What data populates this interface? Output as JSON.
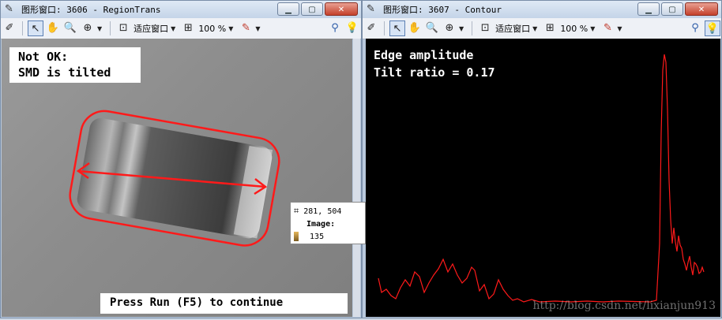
{
  "left_window": {
    "title": "图形窗口: 3606 - RegionTrans",
    "fit_label": "适应窗口",
    "zoom": "100 %",
    "status_lines": [
      "Not OK:",
      "SMD is tilted"
    ],
    "hint": "Press Run (F5) to continue",
    "tooltip": {
      "coords": "281, 504",
      "image_label": "Image:",
      "value": "135"
    }
  },
  "right_window": {
    "title": "图形窗口: 3607 - Contour",
    "fit_label": "适应窗口",
    "zoom": "100 %",
    "plot_title": "Edge amplitude",
    "plot_ratio": "Tilt ratio = 0.17"
  },
  "watermark": "http://blog.csdn.net/lixianjun913",
  "colors": {
    "titlebar": "#c4d4e8",
    "contour": "#ff1a1a",
    "plot_bg": "#000000"
  }
}
